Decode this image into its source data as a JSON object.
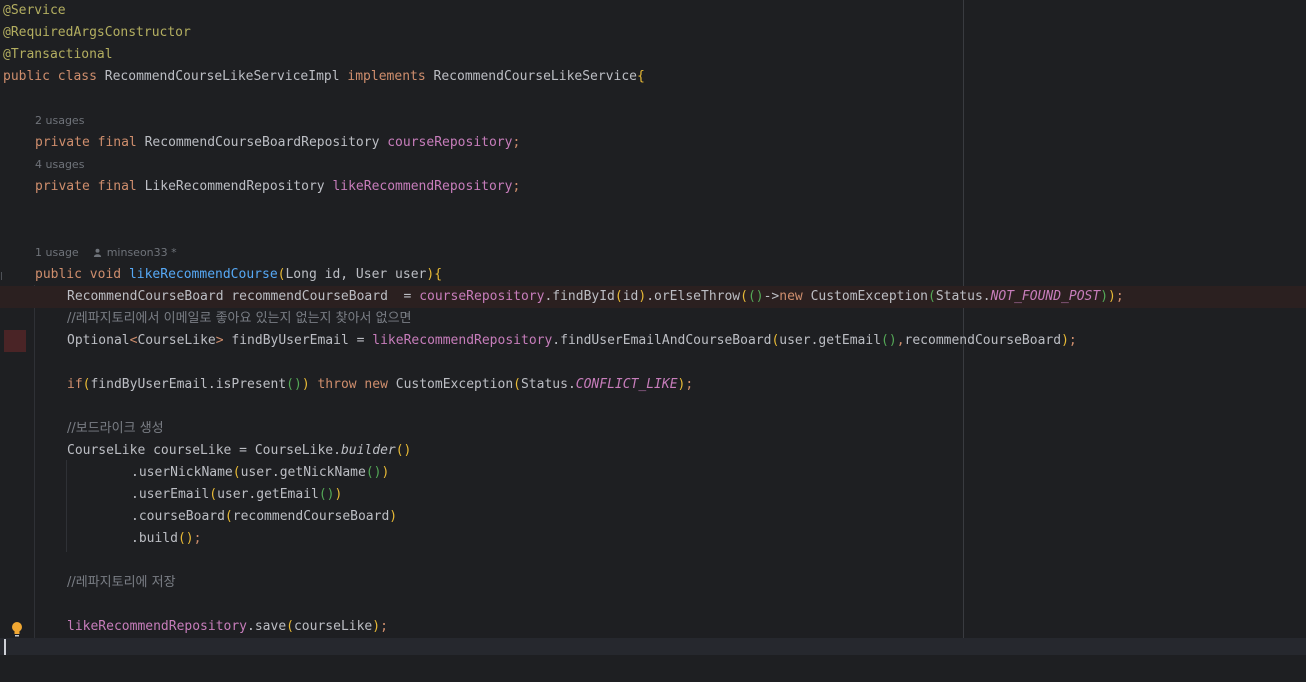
{
  "editor": {
    "annotations": [
      "@Service",
      "@RequiredArgsConstructor",
      "@Transactional"
    ],
    "class_decl": {
      "kw_public": "public",
      "kw_class": "class",
      "class_name": "RecommendCourseLikeServiceImpl",
      "kw_implements": "implements",
      "interface_name": "RecommendCourseLikeService",
      "brace": "{"
    },
    "fields": [
      {
        "usages": "2 usages",
        "kw_private": "private",
        "kw_final": "final",
        "type": "RecommendCourseBoardRepository",
        "name": "courseRepository",
        "semi": ";"
      },
      {
        "usages": "4 usages",
        "kw_private": "private",
        "kw_final": "final",
        "type": "LikeRecommendRepository",
        "name": "likeRecommendRepository",
        "semi": ";"
      }
    ],
    "method_hint": {
      "usages": "1 usage",
      "author": "minseon33 *"
    },
    "method_sig": {
      "kw_public": "public",
      "kw_void": "void",
      "name": "likeRecommendCourse",
      "p_open": "(",
      "params": "Long id, User user",
      "p_close": ")",
      "brace": "{"
    },
    "line1": {
      "decl": "RecommendCourseBoard recommendCourseBoard  = ",
      "field": "courseRepository",
      "call": ".findById",
      "p1o": "(",
      "arg": "id",
      "p1c": ")",
      "call2": ".orElseThrow",
      "p2o": "(",
      "lam_o": "(",
      "lam_c": ")",
      "arrow": "->",
      "kw_new": "new",
      "exc": " CustomException",
      "p3o": "(",
      "status": "Status.",
      "const": "NOT_FOUND_POST",
      "p3c": ")",
      "p2c": ")",
      "semi": ";"
    },
    "comment1": "//레파지토리에서 이메일로 좋아요 있는지 없는지 찾아서 없으면",
    "line2": {
      "type": "Optional",
      "lt": "<",
      "generic": "CourseLike",
      "gt": ">",
      "decl": " findByUserEmail = ",
      "field": "likeRecommendRepository",
      "call": ".findUserEmailAndCourseBoard",
      "p1o": "(",
      "arg1": "user.getEmail",
      "p2": "()",
      "comma": ",",
      "arg2": "recommendCourseBoard",
      "p1c": ")",
      "semi": ";"
    },
    "line3": {
      "kw_if": "if",
      "p1o": "(",
      "cond": "findByUserEmail.isPresent",
      "p2": "()",
      "p1c": ")",
      "kw_throw": " throw",
      "kw_new": " new",
      "exc": " CustomException",
      "p3o": "(",
      "status": "Status.",
      "const": "CONFLICT_LIKE",
      "p3c": ")",
      "semi": ";"
    },
    "comment2": "//보드라이크 생성",
    "line4": {
      "decl": "CourseLike courseLike = CourseLike.",
      "call": "builder",
      "p": "()"
    },
    "builder_lines": [
      {
        "call": ".userNickName",
        "o": "(",
        "arg": "user.getNickName",
        "p": "()",
        "c": ")"
      },
      {
        "call": ".userEmail",
        "o": "(",
        "arg": "user.getEmail",
        "p": "()",
        "c": ")"
      },
      {
        "call": ".courseBoard",
        "o": "(",
        "arg": "recommendCourseBoard",
        "p": "",
        "c": ")"
      },
      {
        "call": ".build",
        "o": "",
        "arg": "",
        "p": "()",
        "c": ";"
      }
    ],
    "comment3": "//레파지토리에 저장",
    "line5": {
      "field": "likeRecommendRepository",
      "call": ".save",
      "o": "(",
      "arg": "courseLike",
      "c": ")",
      "semi": ";"
    }
  },
  "colors": {
    "background": "#1e1f22",
    "keyword": "#cf8e6d",
    "annotation": "#b3ae60",
    "field": "#c77dbb",
    "method": "#56a8f5",
    "comment": "#7a7e85",
    "text": "#bcbec4"
  },
  "icons": [
    "user-icon",
    "lightbulb-icon",
    "fold-marker-icon"
  ]
}
